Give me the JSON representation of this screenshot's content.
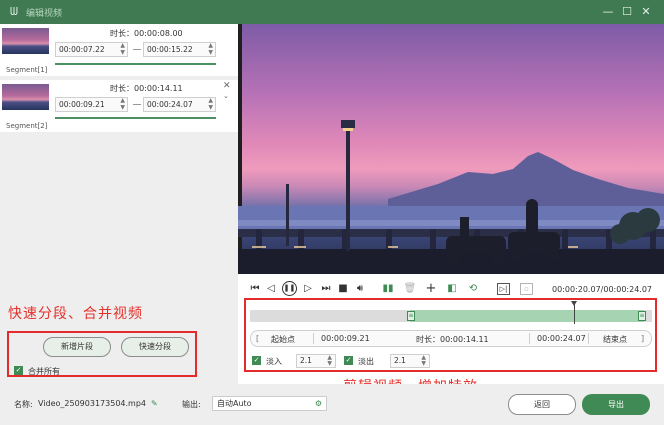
{
  "titlebar": {
    "title": "编辑视频",
    "logo_icon": "app-logo-icon",
    "minimize": "—",
    "maximize": "☐",
    "close": "✕"
  },
  "segments": [
    {
      "label": "Segment[1]",
      "duration": "时长：00:00:08.00",
      "start": "00:00:07.22",
      "end": "00:00:15.22"
    },
    {
      "label": "Segment[2]",
      "duration": "时长：00:00:14.11",
      "start": "00:00:09.21",
      "end": "00:00:24.07"
    }
  ],
  "annotations": {
    "left": "快速分段、合并视频",
    "right": "剪辑视频、增加特效"
  },
  "segment_actions": {
    "add_segment": "新增片段",
    "quick_split": "快速分段",
    "merge_all": "合并所有"
  },
  "player": {
    "time_readout": "00:00:20.07/00:00:24.07"
  },
  "trim": {
    "start_label": "起始点",
    "start_value": "00:00:09.21",
    "duration": "时长：00:00:14.11",
    "end_value": "00:00:24.07",
    "end_label": "结束点"
  },
  "effects": {
    "fade_in_label": "淡入",
    "fade_in_value": "2.1",
    "fade_out_label": "淡出",
    "fade_out_value": "2.1"
  },
  "bottom": {
    "name_label": "名称:",
    "file_name": "Video_250903173504.mp4",
    "output_label": "输出:",
    "output_value": "自动Auto",
    "back_button": "返回",
    "export_button": "导出"
  },
  "colors": {
    "accent": "#3f8a55",
    "annotation": "#e42b2b"
  }
}
